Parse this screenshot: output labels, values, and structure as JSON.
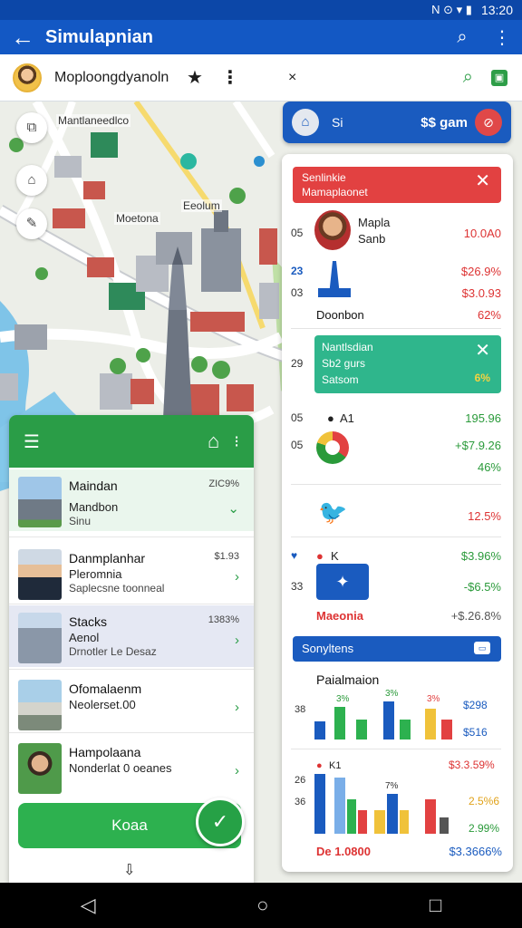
{
  "status_bar": {
    "time": "13:20",
    "icons": [
      "N",
      "⊙",
      "▾",
      "▮",
      "▮"
    ]
  },
  "app_bar": {
    "back_icon": "←",
    "title": "Simulapnian",
    "search_icon": "⌕",
    "more_icon": "⋮"
  },
  "toolbar": {
    "name": "Moploongdyanoln",
    "star": "★",
    "more": "⋮",
    "close": "×",
    "search": "⌕",
    "bag": "▣"
  },
  "map_labels": [
    "Mantlaneedlco",
    "Moetona",
    "Eeolum"
  ],
  "info_pill": {
    "label": "Si",
    "amount": "$$ gam",
    "badge": "⊘"
  },
  "right_panel": {
    "red_banner": {
      "line1": "Senlinkie",
      "line2": "Mamaplaonet",
      "close": "✕"
    },
    "rows": [
      {
        "num": "05",
        "text": "Mapla",
        "sub": "Sanb",
        "value": "10.0A0",
        "value_color": "red"
      },
      {
        "num": "23",
        "text": "",
        "value": "$26.9%",
        "value_color": "red"
      },
      {
        "num": "03",
        "text": "",
        "value": "$3.0.93",
        "value_color": "red"
      },
      {
        "num": "",
        "text": "Doonbon",
        "value": "62%",
        "value_color": "red"
      }
    ],
    "green_banner": {
      "line1": "Nantlsdian",
      "line2": "Sb2 gurs",
      "line3": "Satsom",
      "close": "✕",
      "pct": "6%"
    },
    "rows2": [
      {
        "num": "29",
        "text": "",
        "value": "",
        "value_color": ""
      },
      {
        "num": "05",
        "text": "A1",
        "value": "195.96",
        "value_color": "green"
      },
      {
        "num": "",
        "text": "",
        "value": "+$7.9.26",
        "value_color": "green"
      },
      {
        "num": "",
        "text": "",
        "value": "46%",
        "value_color": "green"
      },
      {
        "num": "",
        "text": "",
        "value": "12.5%",
        "value_color": "red"
      },
      {
        "num": "",
        "text": "K",
        "value": "$3.96%",
        "value_color": "green"
      },
      {
        "num": "33",
        "text": "",
        "value": "-$6.5%",
        "value_color": "green"
      },
      {
        "num": "",
        "text": "Maeonia",
        "value": "+$.26.8%",
        "value_color": "gray"
      }
    ],
    "blue_banner": {
      "title": "Sonyltens",
      "icon": "▭"
    },
    "chart_title": "Paialmaion",
    "chart1": {
      "labels": [
        "3%",
        "3%",
        "3%"
      ],
      "left_num": "38",
      "right_values": [
        "$298",
        "$516"
      ]
    },
    "chart2": {
      "left_label": "K1",
      "left_nums": [
        "26",
        "36"
      ],
      "right_values": [
        "$3.3.59%",
        "2.5%6",
        "2.99%"
      ]
    },
    "footer_left": "De 1.0800",
    "footer_right": "$3.3666%"
  },
  "left_panel": {
    "items": [
      {
        "title": "Maindan",
        "sub1": "Mandbon",
        "sub2": "Sinu",
        "value": "ZIC9%",
        "chev": "⌄"
      },
      {
        "title": "Danmplanhar",
        "sub1": "Pleromnia",
        "sub2": "Saplecsne toonneal",
        "value": "$1.93",
        "chev": "›"
      },
      {
        "title": "Stacks",
        "sub1": "Aenol",
        "sub2": "Drnotler Le Desaz",
        "value": "1383%",
        "chev": "›"
      },
      {
        "title": "Ofomalaenm",
        "sub1": "Neolerset.00",
        "sub2": "",
        "value": "",
        "chev": "›"
      },
      {
        "title": "Hampolaana",
        "sub1": "Nonderlat 0 oeanes",
        "sub2": "",
        "value": "",
        "chev": "›"
      }
    ],
    "primary_button": "Koaa",
    "fab_icon": "✓",
    "bottom_arrow": "⇩"
  },
  "nav": {
    "back": "◁",
    "home": "○",
    "recent": "□"
  }
}
